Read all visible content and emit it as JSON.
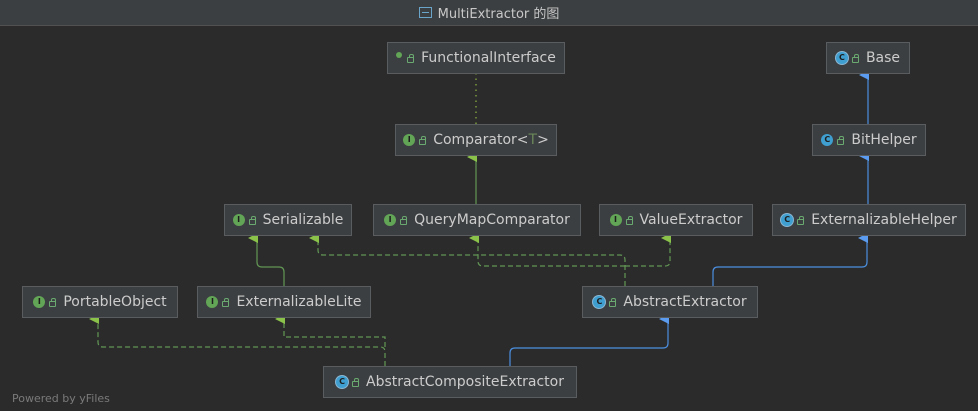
{
  "window": {
    "title": "MultiExtractor 的图",
    "title_icon": "diagram-icon"
  },
  "nodes": {
    "functional_interface": {
      "label": "FunctionalInterface",
      "kind": "annotation"
    },
    "base": {
      "label": "Base",
      "kind": "abstract-class"
    },
    "comparator": {
      "label": "Comparator",
      "generic": "T",
      "kind": "interface"
    },
    "bithelper": {
      "label": "BitHelper",
      "kind": "class"
    },
    "serializable": {
      "label": "Serializable",
      "kind": "interface"
    },
    "querymapcomparator": {
      "label": "QueryMapComparator",
      "kind": "interface"
    },
    "valueextractor": {
      "label": "ValueExtractor",
      "kind": "interface"
    },
    "externalizablehelper": {
      "label": "ExternalizableHelper",
      "kind": "abstract-class"
    },
    "portableobject": {
      "label": "PortableObject",
      "kind": "interface"
    },
    "externalizablelite": {
      "label": "ExternalizableLite",
      "kind": "interface"
    },
    "abstractextractor": {
      "label": "AbstractExtractor",
      "kind": "abstract-class"
    },
    "abstractcompositeextractor": {
      "label": "AbstractCompositeExtractor",
      "kind": "abstract-class"
    }
  },
  "colors": {
    "background": "#2b2b2b",
    "node_fill": "#3c3f41",
    "node_border": "#5a5d5f",
    "implements_edge": "#629755",
    "extends_edge": "#4b8fe0",
    "annotation_edge": "#7a9a3c"
  },
  "footer": {
    "powered_by": "Powered by yFiles"
  }
}
